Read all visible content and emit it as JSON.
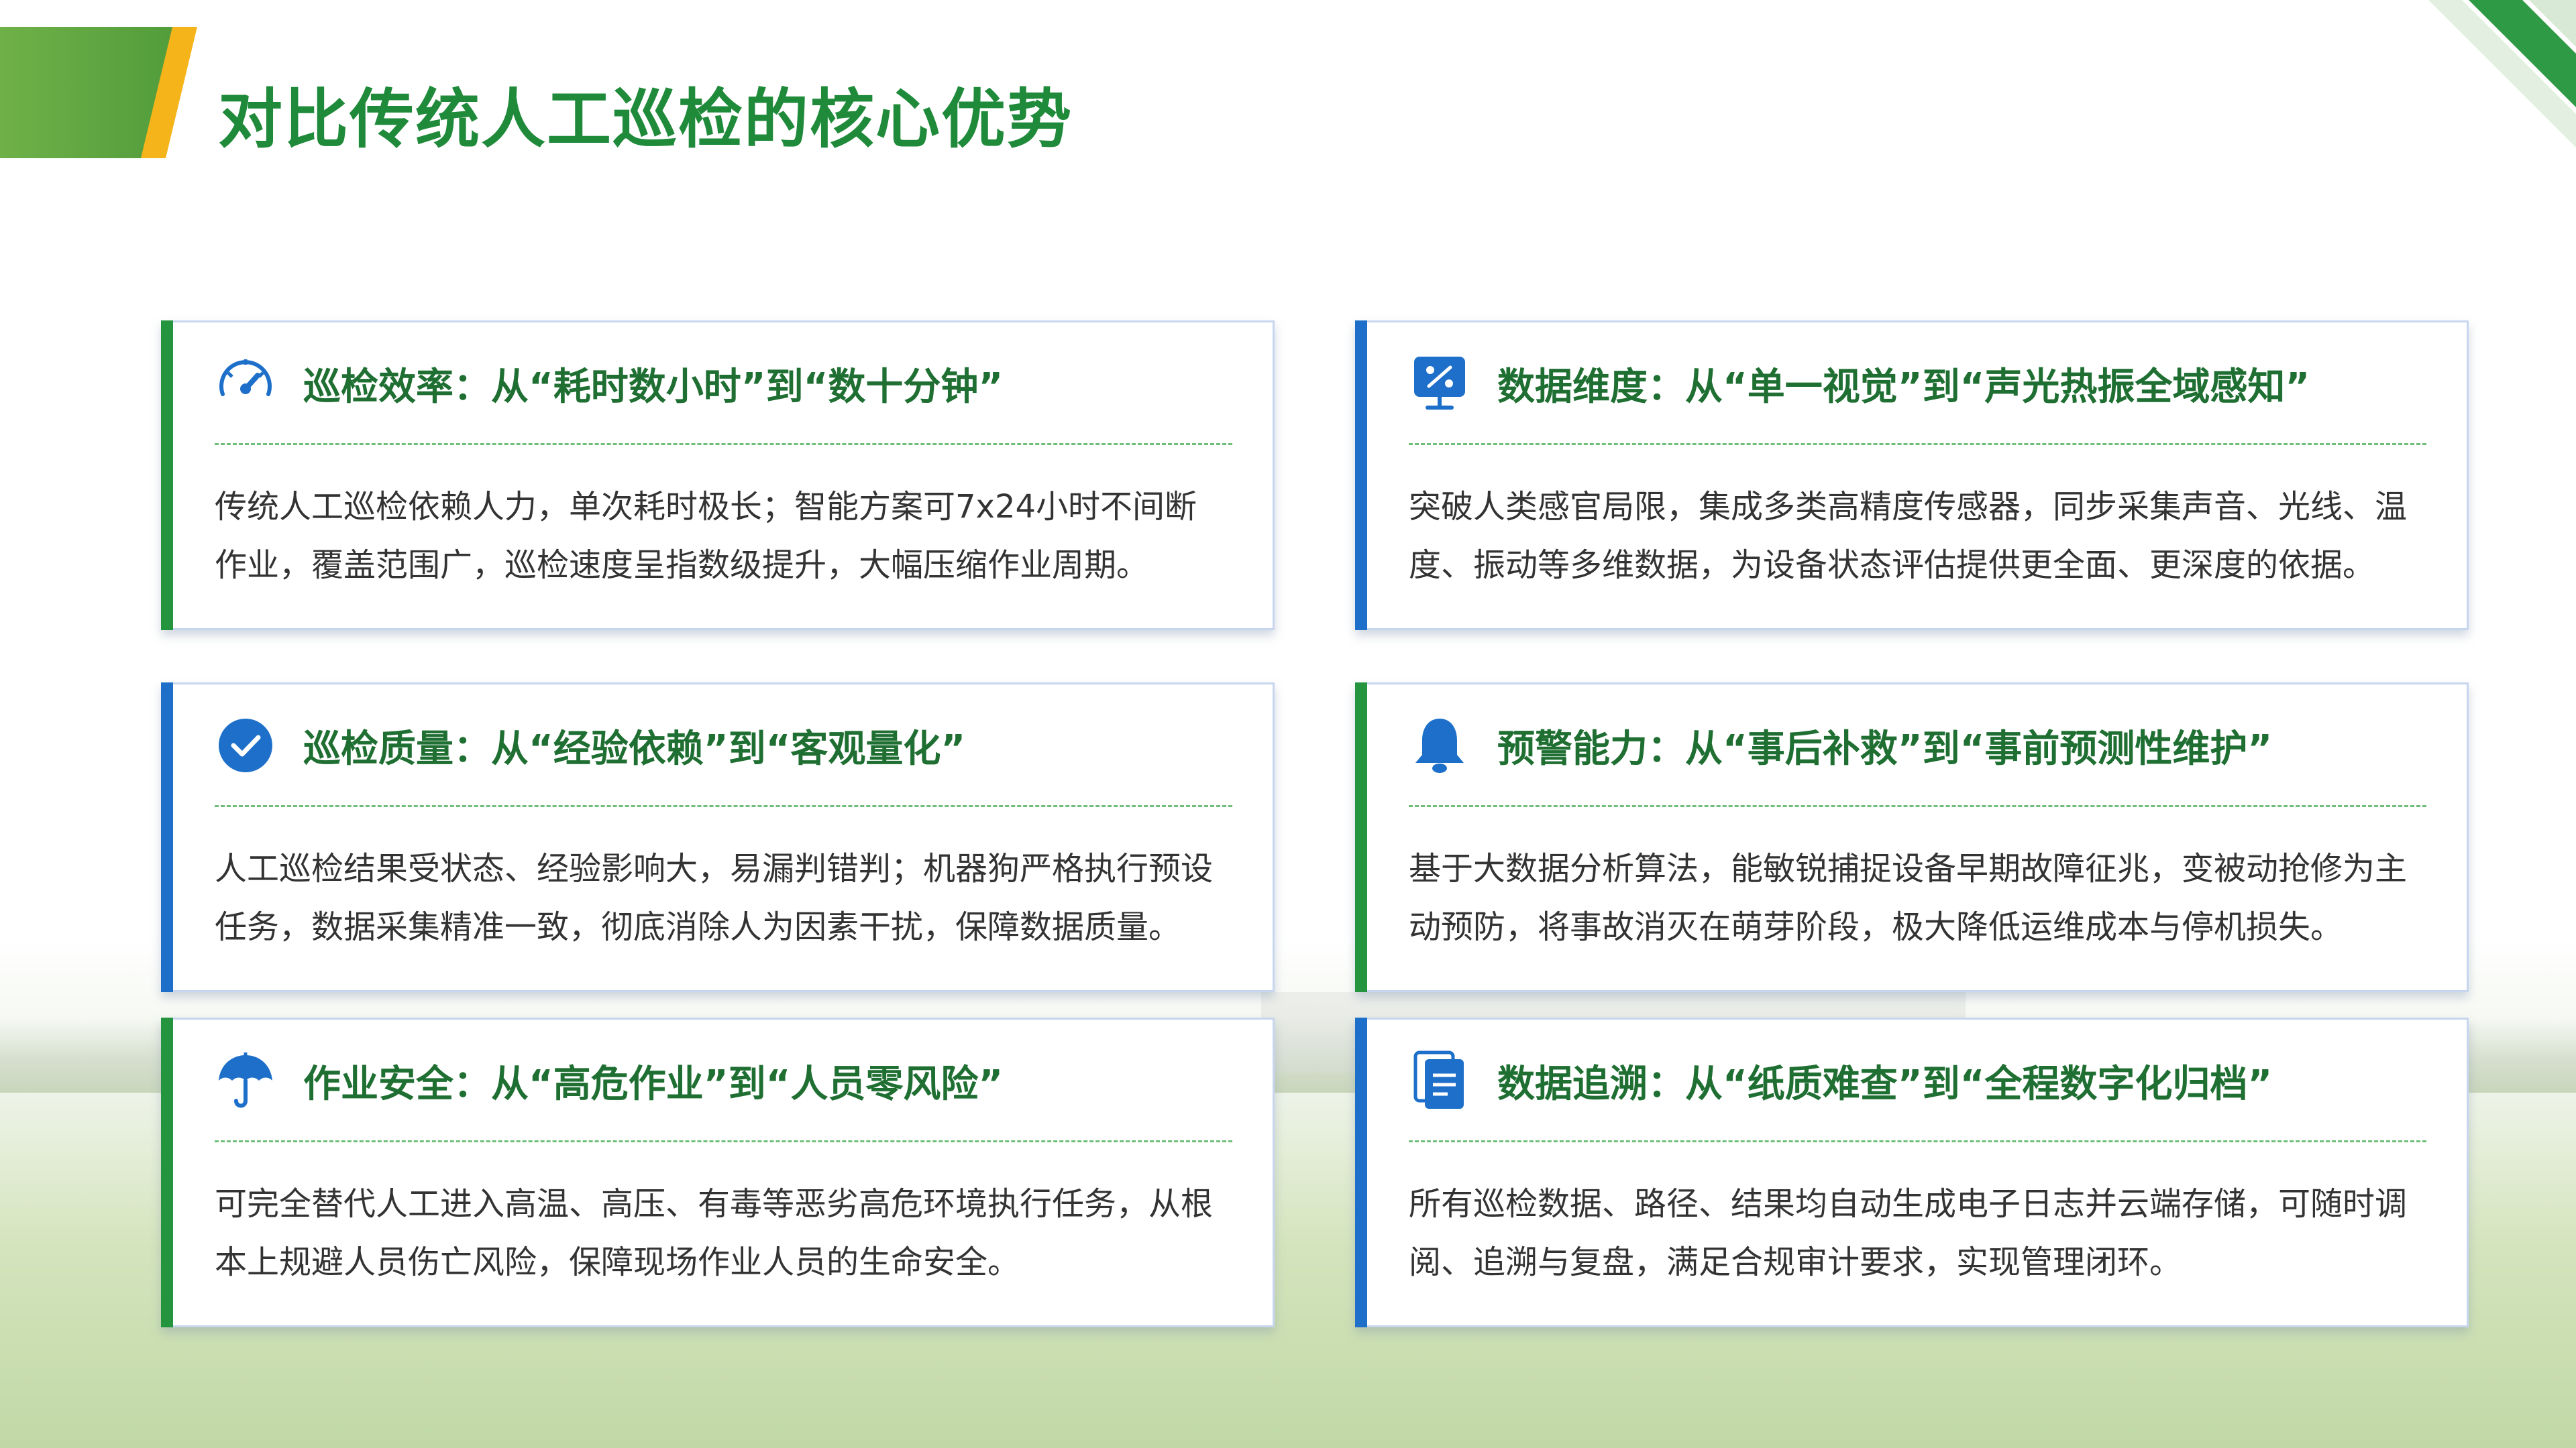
{
  "page": {
    "title": "对比传统人工巡检的核心优势"
  },
  "colors": {
    "title_green": "#1f8a3a",
    "accent_green": "#24943e",
    "accent_blue": "#1d6fc9",
    "header_orange": "#f5b41a"
  },
  "cards": [
    {
      "icon": "speedometer-icon",
      "title": "巡检效率：从“耗时数小时”到“数十分钟”",
      "body": "传统人工巡检依赖人力，单次耗时极长；智能方案可7x24小时不间断作业，覆盖范围广，巡检速度呈指数级提升，大幅压缩作业周期。"
    },
    {
      "icon": "monitor-chart-icon",
      "title": "数据维度：从“单一视觉”到“声光热振全域感知”",
      "body": "突破人类感官局限，集成多类高精度传感器，同步采集声音、光线、温度、振动等多维数据，为设备状态评估提供更全面、更深度的依据。"
    },
    {
      "icon": "check-circle-icon",
      "title": "巡检质量：从“经验依赖”到“客观量化”",
      "body": "人工巡检结果受状态、经验影响大，易漏判错判；机器狗严格执行预设任务，数据采集精准一致，彻底消除人为因素干扰，保障数据质量。"
    },
    {
      "icon": "bell-icon",
      "title": "预警能力：从“事后补救”到“事前预测性维护”",
      "body": "基于大数据分析算法，能敏锐捕捉设备早期故障征兆，变被动抢修为主动预防，将事故消灭在萌芽阶段，极大降低运维成本与停机损失。"
    },
    {
      "icon": "umbrella-icon",
      "title": "作业安全：从“高危作业”到“人员零风险”",
      "body": "可完全替代人工进入高温、高压、有毒等恶劣高危环境执行任务，从根本上规避人员伤亡风险，保障现场作业人员的生命安全。"
    },
    {
      "icon": "document-icon",
      "title": "数据追溯：从“纸质难查”到“全程数字化归档”",
      "body": "所有巡检数据、路径、结果均自动生成电子日志并云端存储，可随时调阅、追溯与复盘，满足合规审计要求，实现管理闭环。"
    }
  ]
}
